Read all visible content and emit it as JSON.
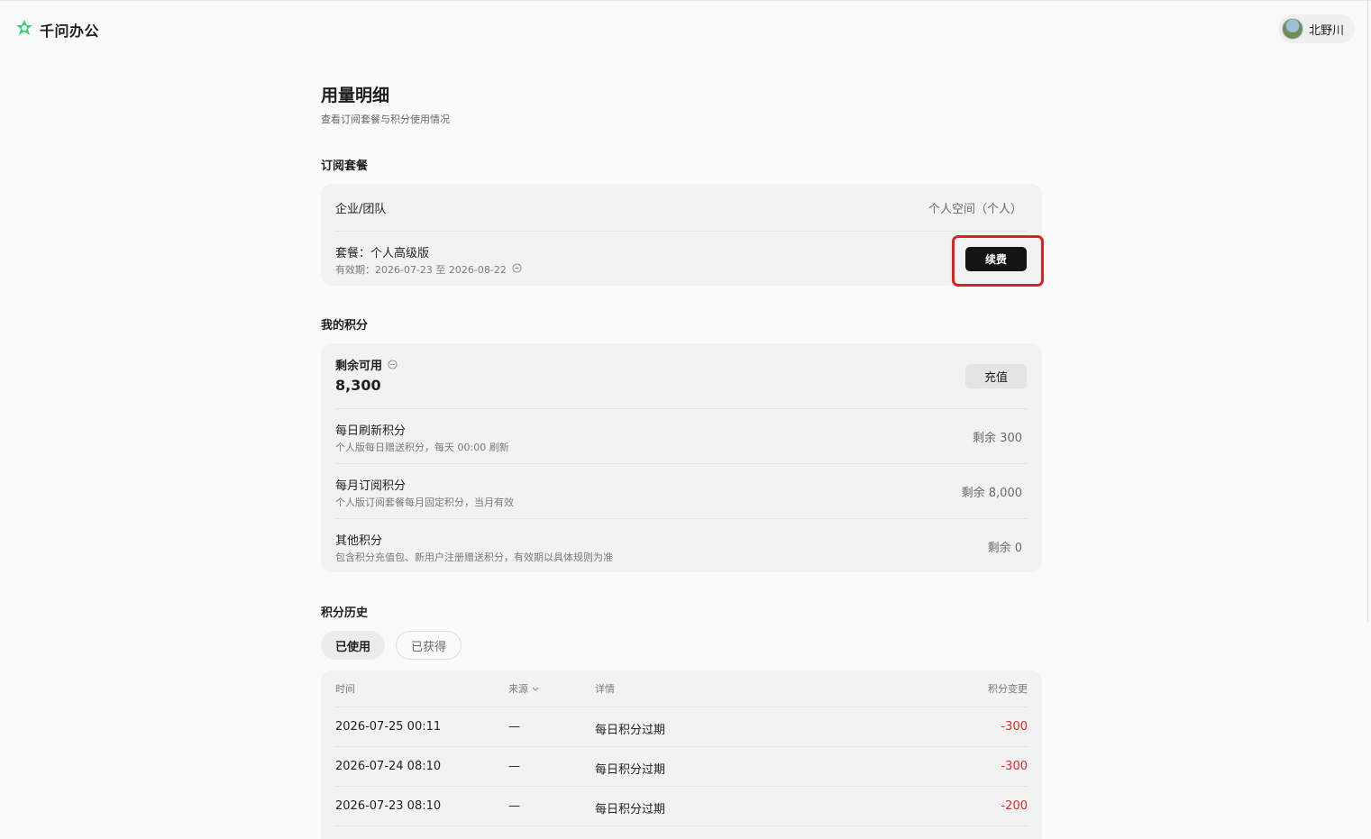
{
  "app": {
    "name": "千问办公",
    "brand_color": "#3ccf7a"
  },
  "user": {
    "name": "北野川"
  },
  "page": {
    "title": "用量明细",
    "subtitle": "查看订阅套餐与积分使用情况"
  },
  "subscription": {
    "section_title": "订阅套餐",
    "org_label": "企业/团队",
    "org_value": "个人空间（个人）",
    "plan_label": "套餐：个人高级版",
    "validity": "有效期：2026-07-23 至 2026-08-22",
    "renew_label": "续费"
  },
  "points": {
    "section_title": "我的积分",
    "available_label": "剩余可用",
    "available_value": "8,300",
    "recharge_label": "充值",
    "items": [
      {
        "title": "每日刷新积分",
        "desc": "个人版每日赠送积分，每天 00:00 刷新",
        "value": "剩余 300"
      },
      {
        "title": "每月订阅积分",
        "desc": "个人版订阅套餐每月固定积分，当月有效",
        "value": "剩余 8,000"
      },
      {
        "title": "其他积分",
        "desc": "包含积分充值包、新用户注册赠送积分，有效期以具体规则为准",
        "value": "剩余 0"
      }
    ]
  },
  "history": {
    "section_title": "积分历史",
    "tabs": [
      {
        "label": "已使用"
      },
      {
        "label": "已获得"
      }
    ],
    "columns": {
      "time": "时间",
      "source": "来源",
      "detail": "详情",
      "change": "积分变更"
    },
    "rows": [
      {
        "time": "2026-07-25 00:11",
        "source": "—",
        "detail": "每日积分过期",
        "change": "-300"
      },
      {
        "time": "2026-07-24 08:10",
        "source": "—",
        "detail": "每日积分过期",
        "change": "-300"
      },
      {
        "time": "2026-07-23 08:10",
        "source": "—",
        "detail": "每日积分过期",
        "change": "-200"
      }
    ]
  }
}
